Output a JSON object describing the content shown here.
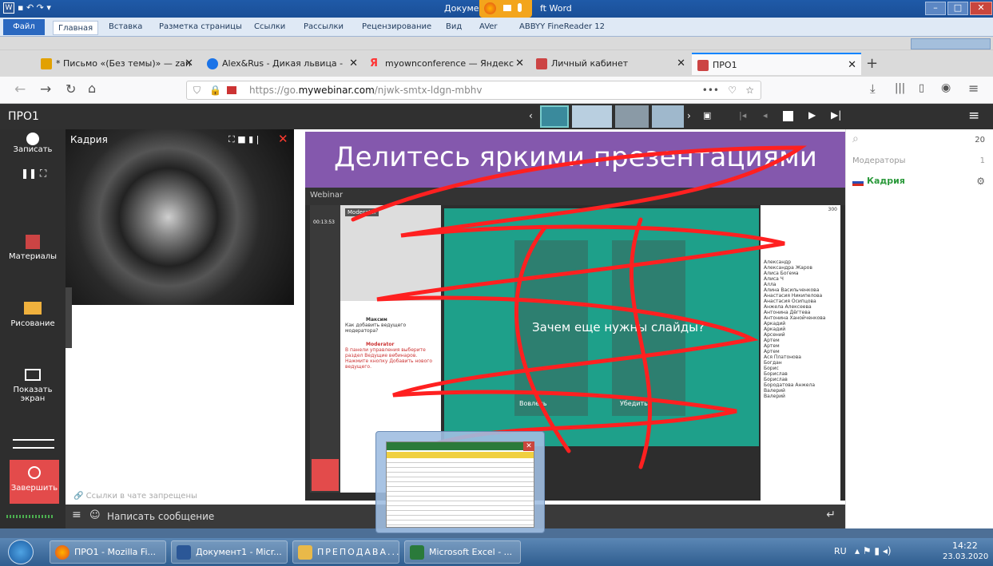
{
  "word": {
    "title_left": "Докуме",
    "title_right": "ft Word",
    "file": "Файл",
    "ribbon": [
      "Главная",
      "Вставка",
      "Разметка страницы",
      "Ссылки",
      "Рассылки",
      "Рецензирование",
      "Вид",
      "AVer",
      "ABBYY FineReader 12"
    ]
  },
  "browser": {
    "tabs": [
      {
        "label": "* Письмо «(Без темы)» — zan",
        "color": "#e2a100"
      },
      {
        "label": "Alex&Rus - Дикая львица -",
        "color": "#1a73e8"
      },
      {
        "label": "myownconference — Яндекс",
        "color": "#f33"
      },
      {
        "label": "Личный кабинет",
        "color": "#c44"
      },
      {
        "label": "ПРО1",
        "color": "#c44"
      }
    ],
    "url_prefix": "https://go.",
    "url_host": "mywebinar.com",
    "url_path": "/njwk-smtx-ldgn-mbhv"
  },
  "app": {
    "title": "ПРО1",
    "left": {
      "record": "Записать",
      "materials": "Материалы",
      "drawing": "Рисование",
      "screen": "Показать экран",
      "finish": "Завершить"
    },
    "camera_name": "Кадрия",
    "slide_title": "Делитесь яркими презентациями",
    "inner": {
      "webinar": "Webinar",
      "moderator": "Moderator",
      "timer": "00:13:53",
      "q_user": "Максим",
      "q_text": "Как добавить ведущего модератора?",
      "a_user": "Moderator",
      "a_text": "В панели управления выберите раздел Ведущие вебинаров. Нажмите кнопку Добавить нового ведущего.",
      "slide_center": "Зачем еще нужны слайды?",
      "left_label": "Вовлечь",
      "right_label": "Убедить",
      "count": "300",
      "names": [
        "Александр",
        "Александра Жаров",
        "Алиса Богема",
        "Алиса Ч",
        "Алла",
        "Алина Васильченкова",
        "Анастасия Никипелова",
        "Анастасия Осипцова",
        "Анжела Алексеева",
        "Антонина Дёгтева",
        "Антонина Ханойченкова",
        "Аркадий",
        "Аркадий",
        "Арсений",
        "Артем",
        "Артем",
        "Артем",
        "Ася Платонова",
        "Богдан",
        "Борис",
        "Борислав",
        "Борислав",
        "Бородатова Анжела",
        "Валерий",
        "Валерий"
      ]
    },
    "chat_note": "Ссылки в чате запрещены",
    "chat_placeholder": "Написать сообщение",
    "search_count": "20",
    "moderators": "Модераторы",
    "moderators_count": "1",
    "user": "Кадрия"
  },
  "taskbar": {
    "items": [
      "ПРО1 - Mozilla Fi...",
      "Документ1 - Micr...",
      "ПРЕПОДАВА...",
      "Microsoft Excel - ..."
    ],
    "lang": "RU",
    "time": "14:22",
    "date": "23.03.2020"
  }
}
